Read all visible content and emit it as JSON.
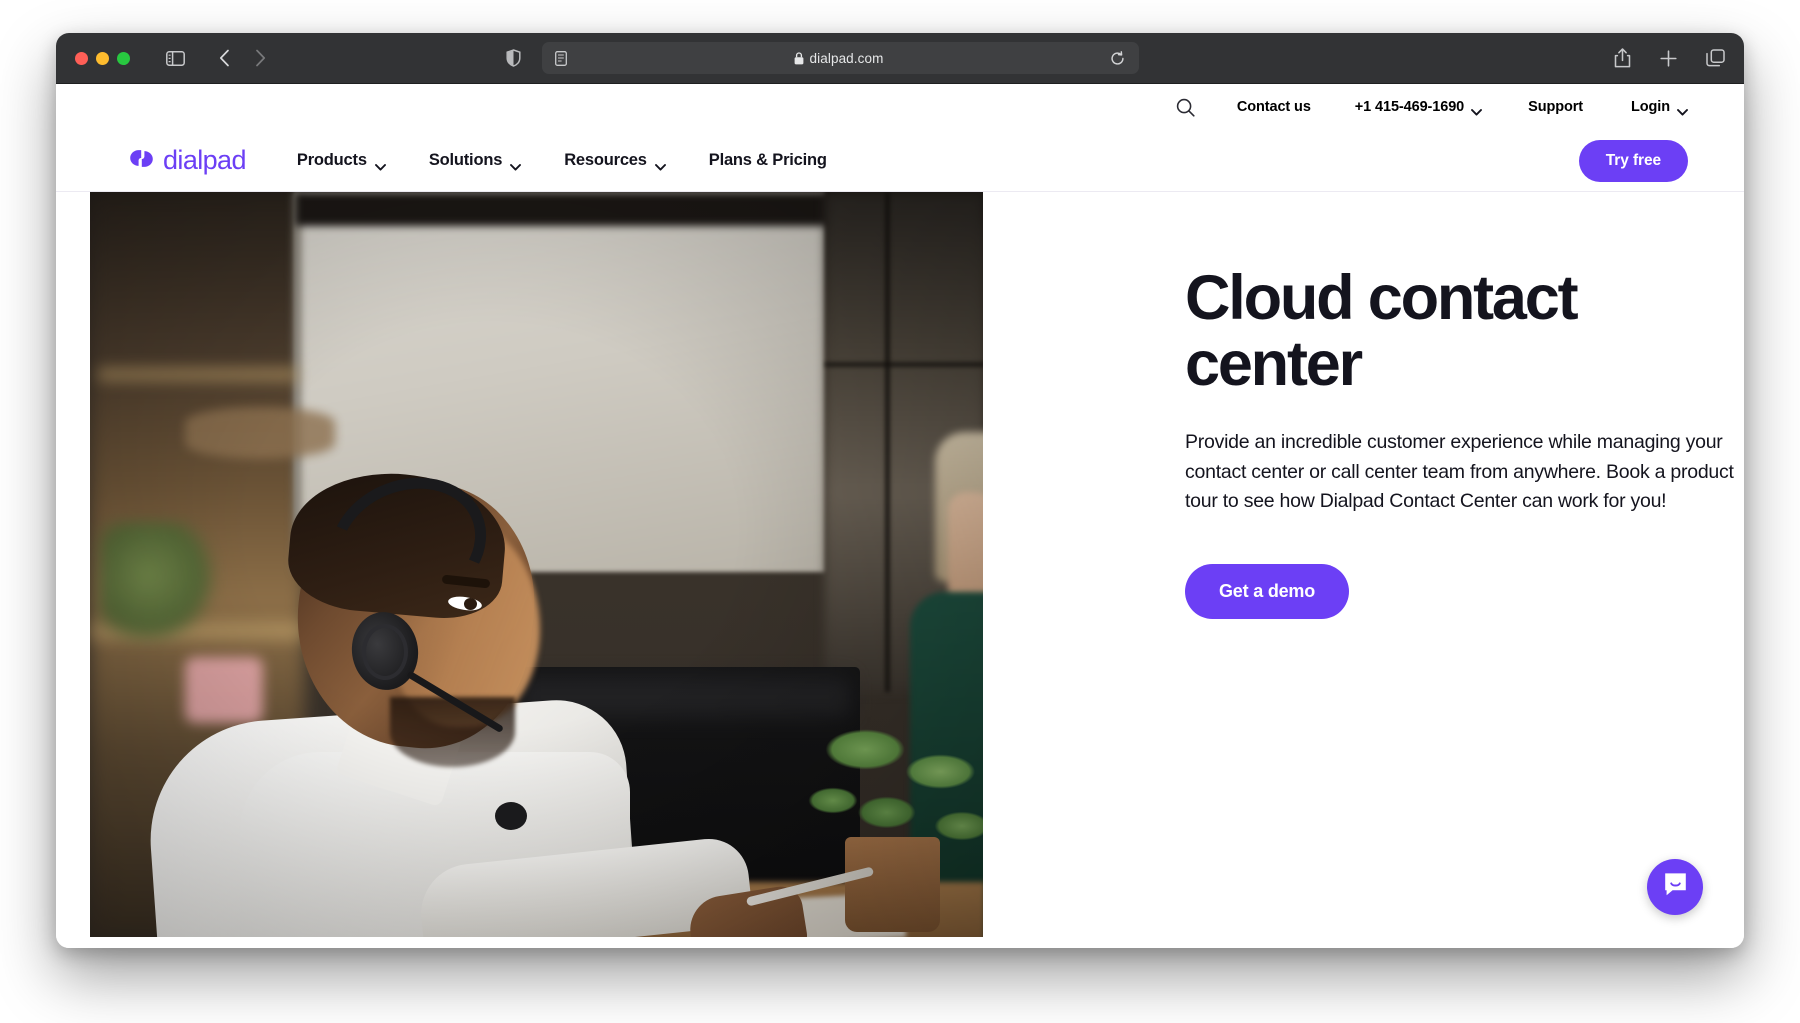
{
  "browser": {
    "traffic_lights": [
      "close",
      "minimize",
      "maximize"
    ],
    "sidebar_icon": "sidebar-icon",
    "back_icon": "chevron-left-icon",
    "forward_icon": "chevron-right-icon",
    "shield_icon": "shield-icon",
    "reader_icon": "reader-view-icon",
    "lock_icon": "lock-icon",
    "url": "dialpad.com",
    "reload_icon": "reload-icon",
    "share_icon": "share-icon",
    "new_tab_icon": "plus-icon",
    "tab_overview_icon": "tab-overview-icon"
  },
  "utility_bar": {
    "search_icon": "search-icon",
    "contact_label": "Contact us",
    "phone_label": "+1 415-469-1690",
    "support_label": "Support",
    "login_label": "Login"
  },
  "nav": {
    "logo_text": "dialpad",
    "links": [
      {
        "label": "Products",
        "has_chevron": true
      },
      {
        "label": "Solutions",
        "has_chevron": true
      },
      {
        "label": "Resources",
        "has_chevron": true
      },
      {
        "label": "Plans & Pricing",
        "has_chevron": false
      }
    ],
    "try_free_label": "Try free"
  },
  "hero": {
    "title": "Cloud contact center",
    "description": "Provide an incredible customer experience while managing your contact center or call center team from anywhere. Book a product tour to see how Dialpad Contact Center can work for you!",
    "cta_label": "Get a demo",
    "image_alt": "Contact center agent wearing a headset at a desk"
  },
  "chat": {
    "launcher_icon": "chat-bubble-icon"
  },
  "colors": {
    "brand_purple": "#6C3FF5",
    "text_dark": "#14141E",
    "toolbar_dark": "#323335",
    "url_field": "#3F4042"
  }
}
